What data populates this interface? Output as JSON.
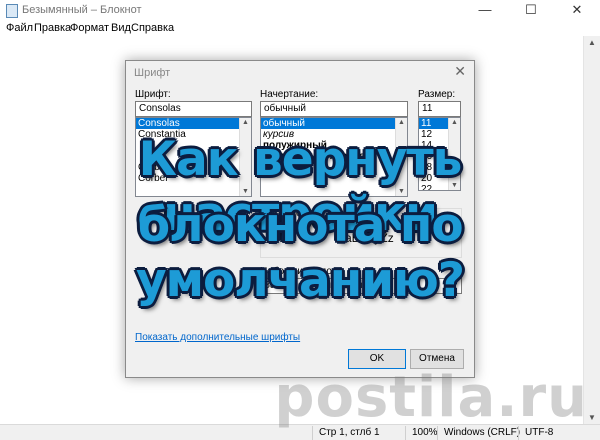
{
  "window": {
    "title": "Безымянный – Блокнот",
    "controls": {
      "minimize": "—",
      "maximize": "☐",
      "close": "✕"
    }
  },
  "menu": [
    "Файл",
    "Правка",
    "Формат",
    "Вид",
    "Справка"
  ],
  "statusbar": {
    "position": "Стр 1, стлб 1",
    "zoom": "100%",
    "line_endings": "Windows (CRLF)",
    "encoding": "UTF-8"
  },
  "font_dialog": {
    "title": "Шрифт",
    "close": "✕",
    "font_label": "Шрифт:",
    "font_value": "Consolas",
    "font_list": [
      "Consolas",
      "Constantia",
      "Corbel",
      "Corbel"
    ],
    "style_label": "Начертание:",
    "style_value": "обычный",
    "style_list": [
      "обычный",
      "курсив",
      "полужирный",
      "полужирный курсив"
    ],
    "size_label": "Размер:",
    "size_value": "11",
    "size_list": [
      "11",
      "12",
      "14",
      "16",
      "18",
      "20",
      "22"
    ],
    "sample_label": "Образец",
    "sample_text": "AaBbYyZz",
    "charset_label": "Набор символов:",
    "charset_value": "Западноевропейский",
    "more_fonts_link": "Показать дополнительные шрифты",
    "ok": "OK",
    "cancel": "Отмена"
  },
  "overlay": {
    "line1": "Как вернуть настройки",
    "line2": "блокнота по умолчанию?"
  },
  "watermark": "postila.ru",
  "colors": {
    "accent": "#0078d7",
    "overlay_text": "#1d9bd6",
    "overlay_outline": "#0c1d3f"
  }
}
